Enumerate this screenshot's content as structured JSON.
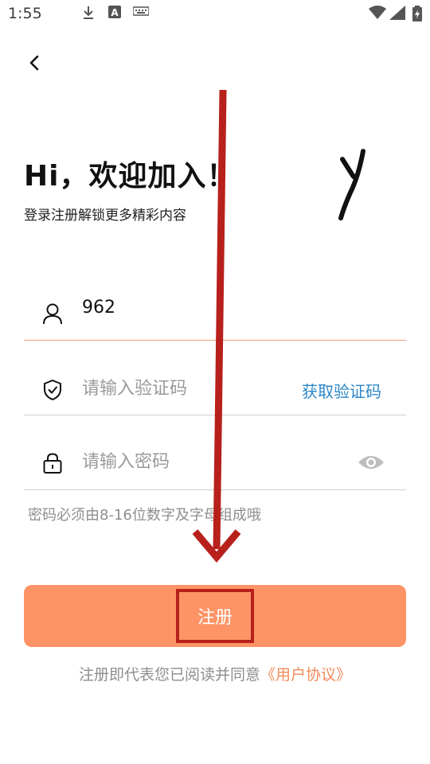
{
  "status_bar": {
    "time": "1:55",
    "icons": [
      "download-icon",
      "a-notification-icon",
      "keyboard-icon",
      "wifi-icon",
      "signal-icon",
      "battery-charging-icon"
    ]
  },
  "header": {
    "back_icon": "chevron-left-icon"
  },
  "welcome": {
    "title": "Hi，欢迎加入！",
    "subtitle": "登录注册解锁更多精彩内容"
  },
  "form": {
    "phone": {
      "icon": "user-icon",
      "value": "962"
    },
    "code": {
      "icon": "shield-check-icon",
      "placeholder": "请输入验证码",
      "action_label": "获取验证码"
    },
    "password": {
      "icon": "lock-icon",
      "placeholder": "请输入密码",
      "toggle_icon": "eye-icon"
    },
    "hint": "密码必须由8-16位数字及字母组成哦"
  },
  "register_button": {
    "label": "注册"
  },
  "agreement": {
    "prefix": "注册即代表您已阅读并同意",
    "link": "《用户协议》"
  },
  "colors": {
    "accent": "#fe9465",
    "link_blue": "#2b86c9",
    "annotation_red": "#b8201c"
  }
}
